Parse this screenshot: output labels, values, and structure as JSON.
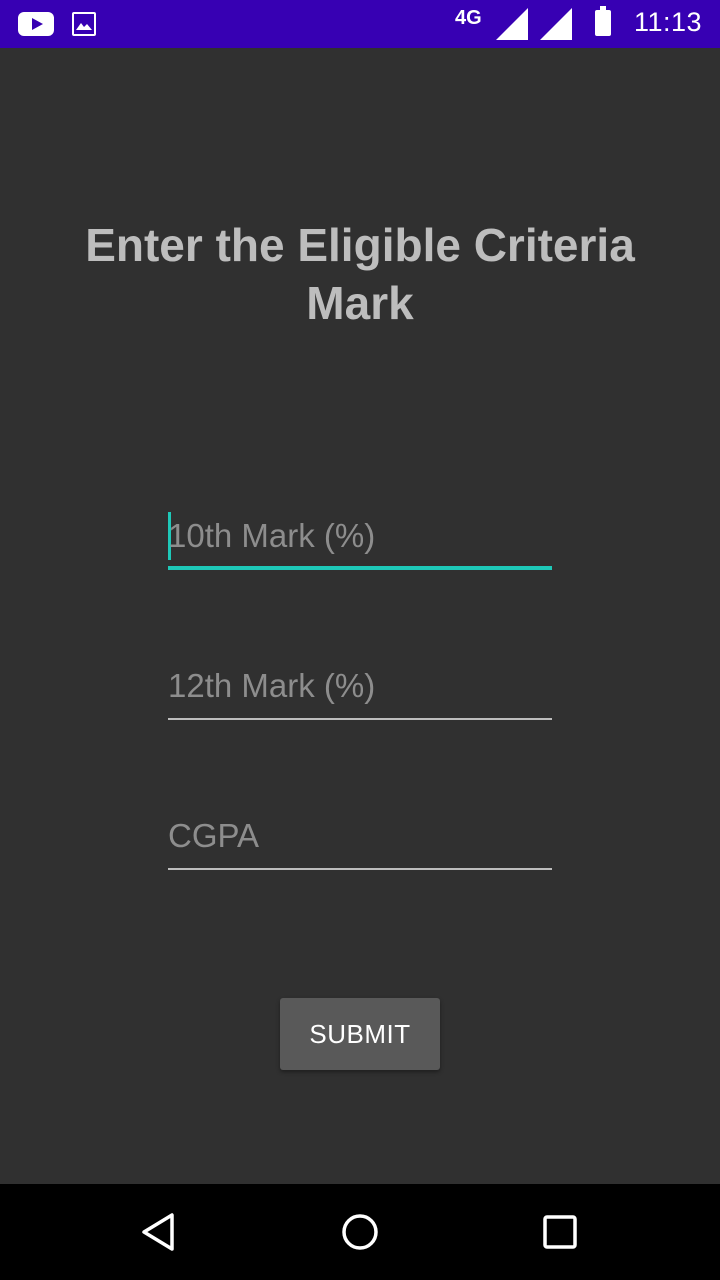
{
  "status_bar": {
    "network": "4G",
    "time": "11:13",
    "icons": [
      "youtube-icon",
      "gallery-icon",
      "signal-icon",
      "signal-icon",
      "battery-icon"
    ],
    "background": "#3700b3"
  },
  "screen": {
    "title": "Enter the Eligible Criteria Mark",
    "background": "#303030"
  },
  "form": {
    "fields": [
      {
        "placeholder": "10th Mark (%)",
        "value": "",
        "focused": true
      },
      {
        "placeholder": "12th Mark (%)",
        "value": "",
        "focused": false
      },
      {
        "placeholder": "CGPA",
        "value": "",
        "focused": false
      }
    ],
    "accent_color": "#1ec8b8",
    "submit_label": "SUBMIT"
  },
  "nav_bar": {
    "icons": [
      "back-icon",
      "home-icon",
      "recents-icon"
    ]
  }
}
